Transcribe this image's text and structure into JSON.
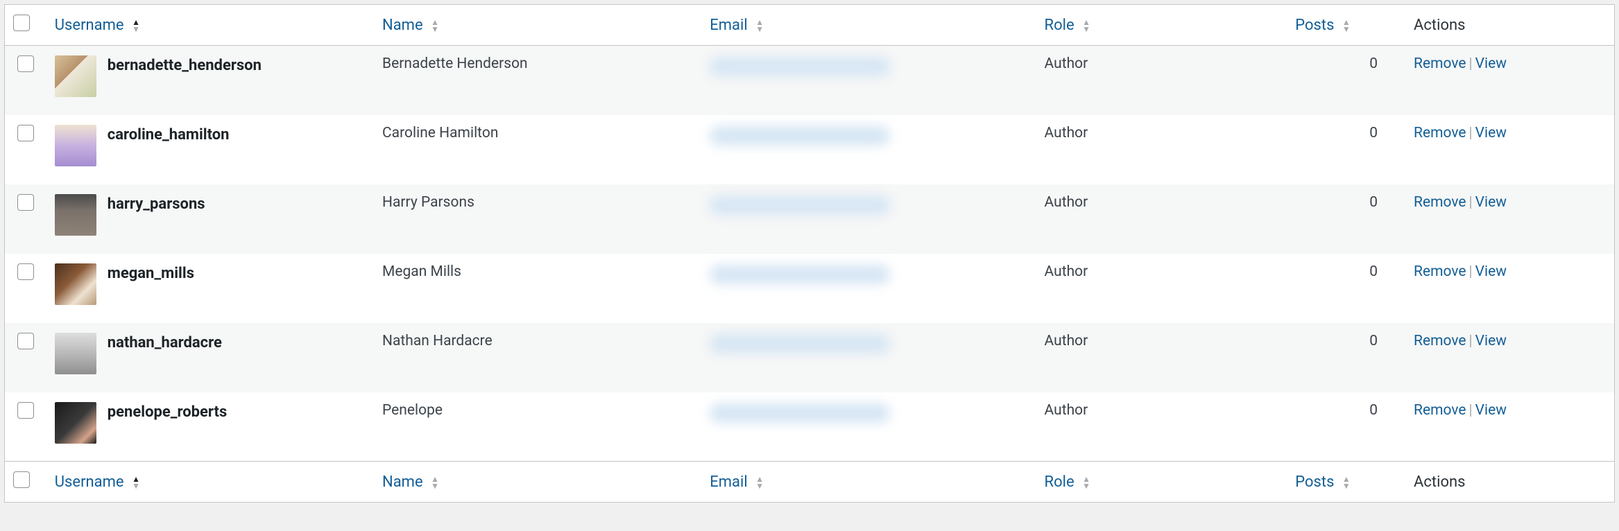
{
  "columns": {
    "username": "Username",
    "name": "Name",
    "email": "Email",
    "role": "Role",
    "posts": "Posts",
    "actions": "Actions"
  },
  "sort": {
    "column": "username",
    "direction": "asc"
  },
  "actions": {
    "remove": "Remove",
    "view": "View"
  },
  "users": [
    {
      "username": "bernadette_henderson",
      "name": "Bernadette Henderson",
      "email_blurred": true,
      "role": "Author",
      "posts": 0
    },
    {
      "username": "caroline_hamilton",
      "name": "Caroline Hamilton",
      "email_blurred": true,
      "role": "Author",
      "posts": 0
    },
    {
      "username": "harry_parsons",
      "name": "Harry Parsons",
      "email_blurred": true,
      "role": "Author",
      "posts": 0
    },
    {
      "username": "megan_mills",
      "name": "Megan Mills",
      "email_blurred": true,
      "role": "Author",
      "posts": 0
    },
    {
      "username": "nathan_hardacre",
      "name": "Nathan Hardacre",
      "email_blurred": true,
      "role": "Author",
      "posts": 0
    },
    {
      "username": "penelope_roberts",
      "name": "Penelope",
      "email_blurred": true,
      "role": "Author",
      "posts": 0
    }
  ]
}
